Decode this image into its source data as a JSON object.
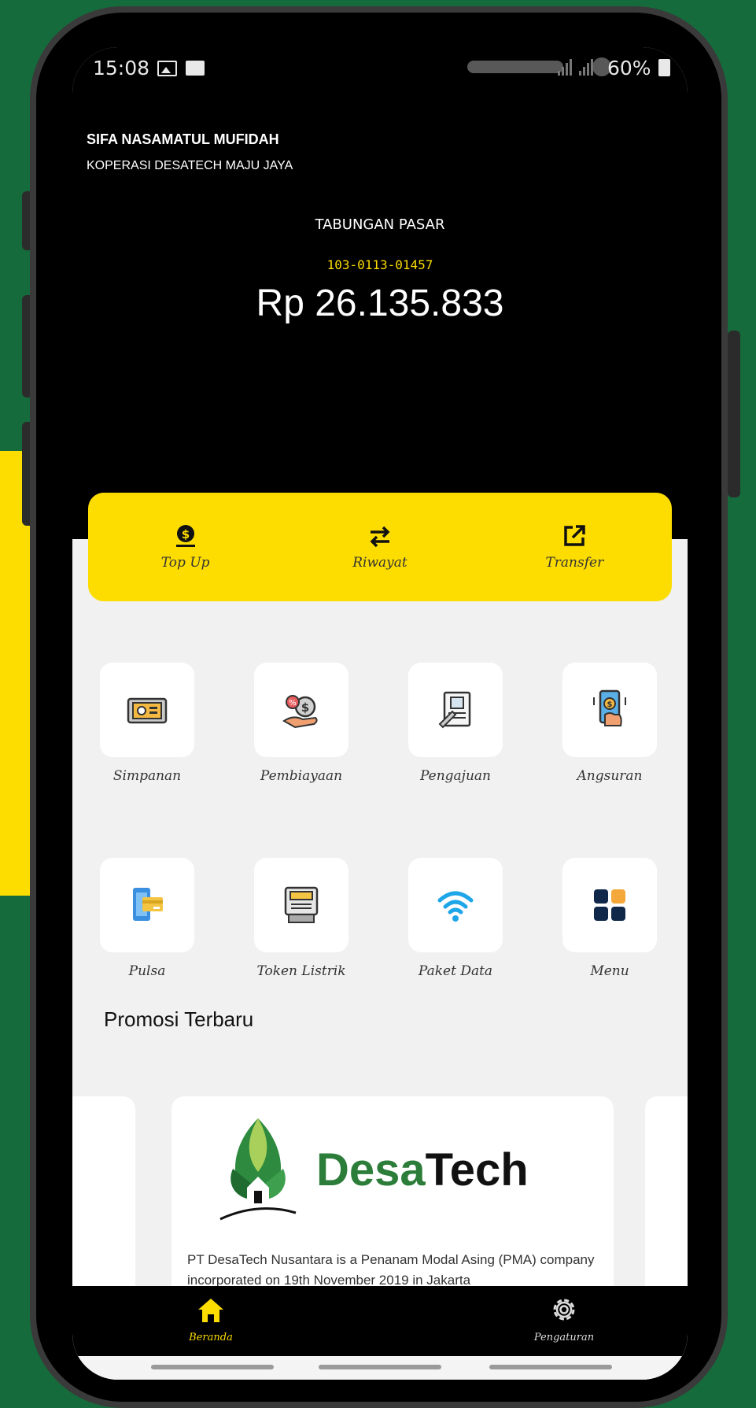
{
  "status_bar": {
    "time": "15:08",
    "battery": "60%"
  },
  "account": {
    "user_name": "SIFA NASAMATUL MUFIDAH",
    "cooperative": "KOPERASI DESATECH MAJU JAYA",
    "type": "TABUNGAN PASAR",
    "number": "103-0113-01457",
    "balance": "Rp 26.135.833"
  },
  "actions": [
    {
      "label": "Top Up",
      "icon": "money-bag-icon"
    },
    {
      "label": "Riwayat",
      "icon": "swap-arrows-icon"
    },
    {
      "label": "Transfer",
      "icon": "external-link-icon"
    }
  ],
  "menu": [
    {
      "label": "Simpanan",
      "icon": "safe-icon"
    },
    {
      "label": "Pembiayaan",
      "icon": "money-hand-icon"
    },
    {
      "label": "Pengajuan",
      "icon": "document-form-icon"
    },
    {
      "label": "Angsuran",
      "icon": "mobile-payment-icon"
    },
    {
      "label": "Pulsa",
      "icon": "phone-card-icon"
    },
    {
      "label": "Token Listrik",
      "icon": "electric-meter-icon"
    },
    {
      "label": "Paket Data",
      "icon": "wifi-icon"
    },
    {
      "label": "Menu",
      "icon": "grid-menu-icon"
    }
  ],
  "promo": {
    "title": "Promosi Terbaru",
    "brand_part1": "Desa",
    "brand_part2": "Tech",
    "text": "PT DesaTech Nusantara is a Penanam Modal Asing (PMA) company incorporated on 19th November 2019 in Jakarta"
  },
  "bottom_nav": [
    {
      "label": "Beranda",
      "icon": "home-icon"
    },
    {
      "label": "Pengaturan",
      "icon": "gear-icon"
    }
  ],
  "colors": {
    "accent": "#fddd00",
    "brand_green": "#156b3b",
    "header": "#000000"
  }
}
